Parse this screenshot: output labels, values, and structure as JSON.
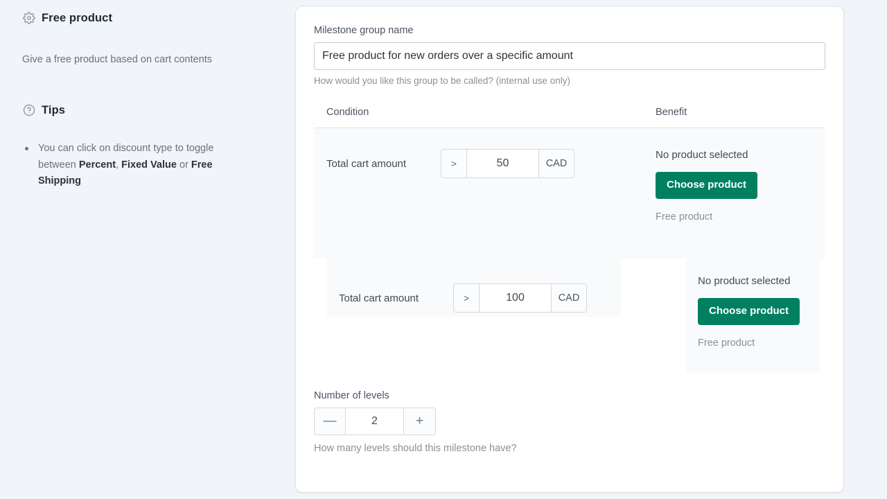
{
  "sidebar": {
    "heading": {
      "icon": "gear-icon",
      "title": "Free product"
    },
    "description": "Give a free product based on cart contents",
    "tips_heading": {
      "icon": "question-circle-icon",
      "title": "Tips"
    },
    "tips": [
      {
        "prefix": "You can click on discount type to toggle between ",
        "bold1": "Percent",
        "sep1": ", ",
        "bold2": "Fixed Value",
        "sep2": " or ",
        "bold3": "Free Shipping"
      }
    ]
  },
  "form": {
    "name_label": "Milestone group name",
    "name_value": "Free product for new orders over a specific amount",
    "name_placeholder": "Milestone group name",
    "name_help": "How would you like this group to be called? (internal use only)",
    "columns": {
      "condition": "Condition",
      "benefit": "Benefit"
    },
    "rows": [
      {
        "condition_label": "Total cart amount",
        "operator": ">",
        "amount": "50",
        "currency": "CAD",
        "benefit_status": "No product selected",
        "benefit_button": "Choose product",
        "benefit_note": "Free product"
      },
      {
        "condition_label": "Total cart amount",
        "operator": ">",
        "amount": "100",
        "currency": "CAD",
        "benefit_status": "No product selected",
        "benefit_button": "Choose product",
        "benefit_note": "Free product"
      }
    ],
    "levels_label": "Number of levels",
    "levels_minus": "—",
    "levels_value": "2",
    "levels_plus": "+",
    "levels_help": "How many levels should this milestone have?"
  },
  "colors": {
    "accent_green": "#008060",
    "page_background": "#f1f4f8",
    "card_background": "#ffffff",
    "row_shade": "#f9fafb"
  }
}
